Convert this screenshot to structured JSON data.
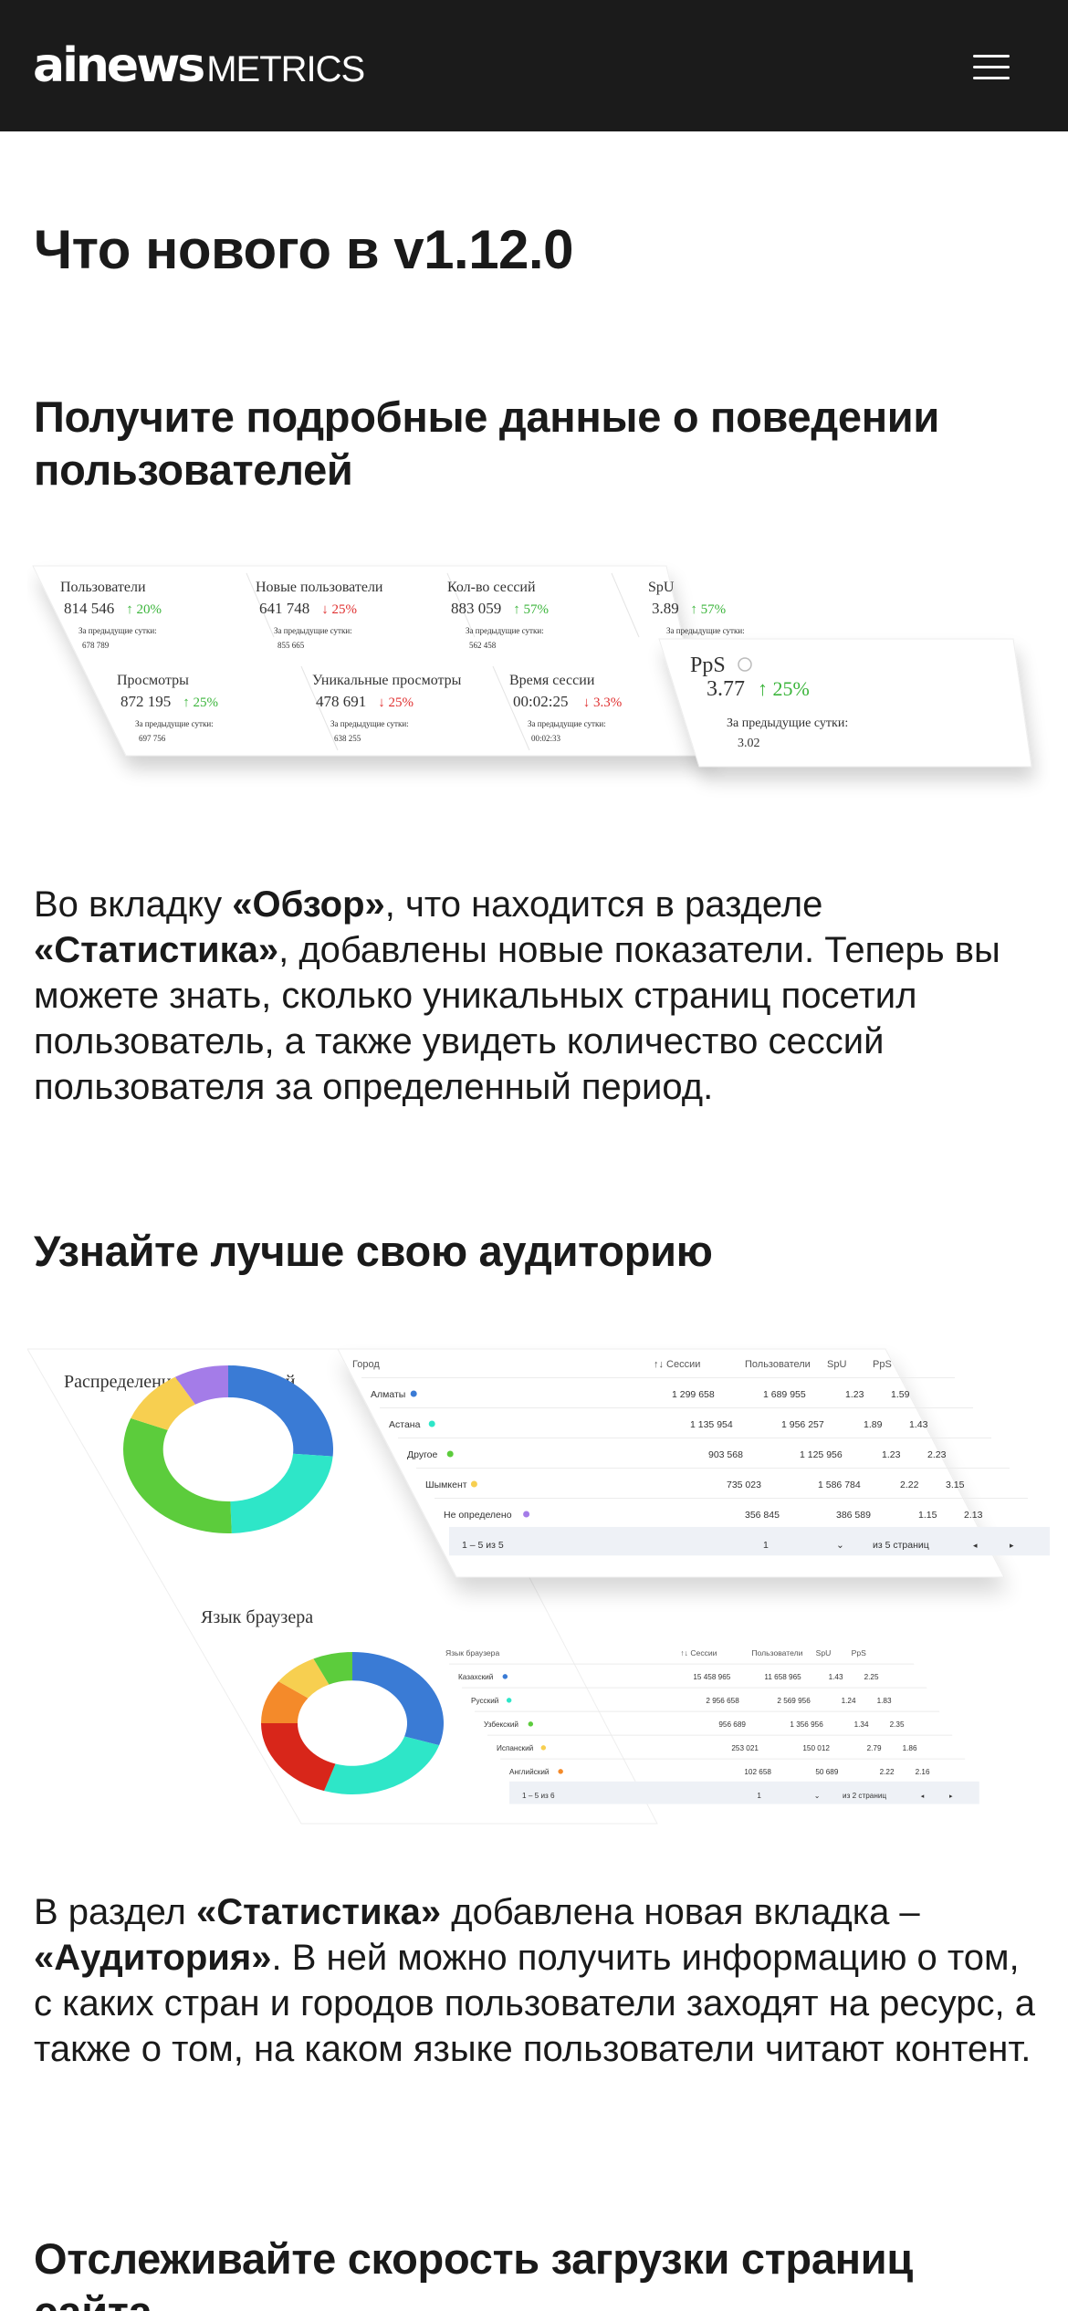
{
  "header": {
    "logo_bold": "ainews",
    "logo_light": "METRICS",
    "menu_icon": "hamburger-menu-icon"
  },
  "page": {
    "title": "Что нового в v1.12.0"
  },
  "section1": {
    "heading": "Получите подробные данные о поведении пользователей",
    "para_parts": [
      "Во вкладку ",
      "«Обзор»",
      ", что находится в разделе ",
      "«Статистика»",
      ", добавлены новые показатели. Теперь вы можете знать, сколько уникальных страниц посетил пользователь, а также увидеть количество сессий пользователя за определенный период."
    ],
    "cards_top": [
      {
        "label": "Пользователи",
        "value": "814 546",
        "delta": "↑ 20%",
        "dir": "up",
        "prev_label": "За предыдущие сутки:",
        "prev": "678 789"
      },
      {
        "label": "Новые пользователи",
        "value": "641 748",
        "delta": "↓ 25%",
        "dir": "down",
        "prev_label": "За предыдущие сутки:",
        "prev": "855 665"
      },
      {
        "label": "Кол-во сессий",
        "value": "883 059",
        "delta": "↑ 57%",
        "dir": "up",
        "prev_label": "За предыдущие сутки:",
        "prev": "562 458"
      },
      {
        "label": "SpU",
        "value": "3.89",
        "delta": "↑ 57%",
        "dir": "up",
        "prev_label": "За предыдущие сутки:",
        "prev": ""
      }
    ],
    "cards_bottom": [
      {
        "label": "Просмотры",
        "value": "872 195",
        "delta": "↑ 25%",
        "dir": "up",
        "prev_label": "За предыдущие сутки:",
        "prev": "697 756"
      },
      {
        "label": "Уникальные просмотры",
        "value": "478 691",
        "delta": "↓ 25%",
        "dir": "down",
        "prev_label": "За предыдущие сутки:",
        "prev": "638 255"
      },
      {
        "label": "Время сессии",
        "value": "00:02:25",
        "delta": "↓ 3.3%",
        "dir": "down",
        "prev_label": "За предыдущие сутки:",
        "prev": "00:02:33"
      }
    ],
    "pps_card": {
      "label": "PpS",
      "value": "3.77",
      "delta": "↑ 25%",
      "prev_label": "За предыдущие сутки:",
      "prev": "3.02"
    }
  },
  "section2": {
    "heading": "Узнайте лучше свою аудиторию",
    "para_parts": [
      "В раздел ",
      "«Статистика»",
      " добавлена новая вкладка – ",
      "«Аудитория»",
      ". В ней можно получить информацию о том, с каких стран и городов пользователи заходят на ресурс, а также о том, на каком языке пользователи читают контент."
    ],
    "donut1_title": "Распределение пользователей",
    "donut2_title": "Язык браузера",
    "city_table": {
      "headers": [
        "Город",
        "↑↓ Сессии",
        "Пользователи",
        "SpU",
        "PpS"
      ],
      "rows": [
        [
          "Алматы",
          "1 299 658",
          "1 689 955",
          "1.23",
          "1.59"
        ],
        [
          "Астана",
          "1 135 954",
          "1 956 257",
          "1.89",
          "1.43"
        ],
        [
          "Другое",
          "903 568",
          "1 125 956",
          "1.23",
          "2.23"
        ],
        [
          "Шымкент",
          "735 023",
          "1 586 784",
          "2.22",
          "3.15"
        ],
        [
          "Не определено",
          "356 845",
          "386 589",
          "1.15",
          "2.13"
        ]
      ],
      "footer_range": "1 – 5 из 5",
      "footer_page": "1",
      "footer_of": "из 5 страниц"
    },
    "lang_table": {
      "headers": [
        "Язык браузера",
        "↑↓ Сессии",
        "Пользователи",
        "SpU",
        "PpS"
      ],
      "rows": [
        [
          "Казахский",
          "15 458 965",
          "11 658 965",
          "1.43",
          "2.25"
        ],
        [
          "Русский",
          "2 956 658",
          "2 569 956",
          "1.24",
          "1.83"
        ],
        [
          "Узбекский",
          "956 689",
          "1 356 956",
          "1.34",
          "2.35"
        ],
        [
          "Испанский",
          "253 021",
          "150 012",
          "2.79",
          "1.86"
        ],
        [
          "Английский",
          "102 658",
          "50 689",
          "2.22",
          "2.16"
        ]
      ],
      "footer_range": "1 – 5 из 6",
      "footer_page": "1",
      "footer_of": "из 2 страниц"
    }
  },
  "section3": {
    "heading": "Отслеживайте скорость загрузки страниц сайта"
  },
  "colors": {
    "header_bg": "#1b1b1b",
    "up": "#3bb53b",
    "down": "#e03030",
    "donut_blue": "#3a7bd5",
    "donut_teal": "#2ee6c8",
    "donut_green": "#5ccc3c",
    "donut_yellow": "#f7cf50",
    "donut_purple": "#a47ce8",
    "donut_red": "#d8261a",
    "donut_orange": "#f48a2a"
  }
}
